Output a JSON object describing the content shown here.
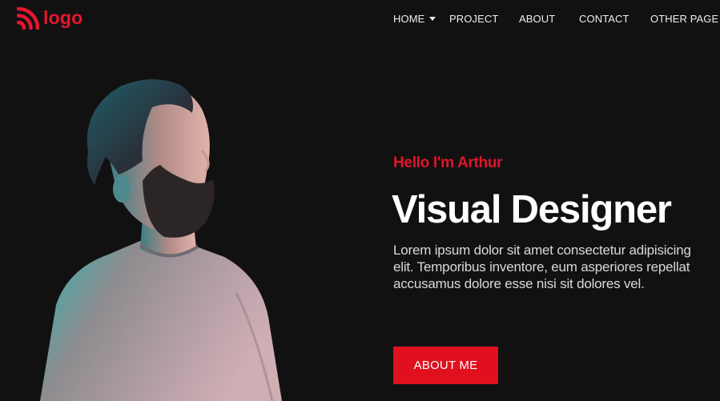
{
  "colors": {
    "background": "#121112",
    "accent": "#e0142a",
    "nav_text": "#eeeeee",
    "heading_text": "#ffffff",
    "body_text": "#d9d9d9"
  },
  "header": {
    "logo": {
      "icon": "rss-feed-icon",
      "text": "logo"
    },
    "nav": [
      {
        "label": "HOME",
        "has_dropdown": true
      },
      {
        "label": "PROJECT",
        "has_dropdown": false
      },
      {
        "label": "ABOUT",
        "has_dropdown": false
      },
      {
        "label": "CONTACT",
        "has_dropdown": false
      },
      {
        "label": "OTHER PAGE",
        "has_dropdown": true
      }
    ]
  },
  "hero": {
    "image": "bearded-man-portrait",
    "greeting": "Hello I'm Arthur",
    "title": "Visual Designer",
    "description": "Lorem ipsum dolor sit amet consectetur adipisicing elit. Temporibus inventore, eum asperiores repellat accusamus dolore esse nisi sit dolores vel.",
    "button_label": "ABOUT ME"
  }
}
